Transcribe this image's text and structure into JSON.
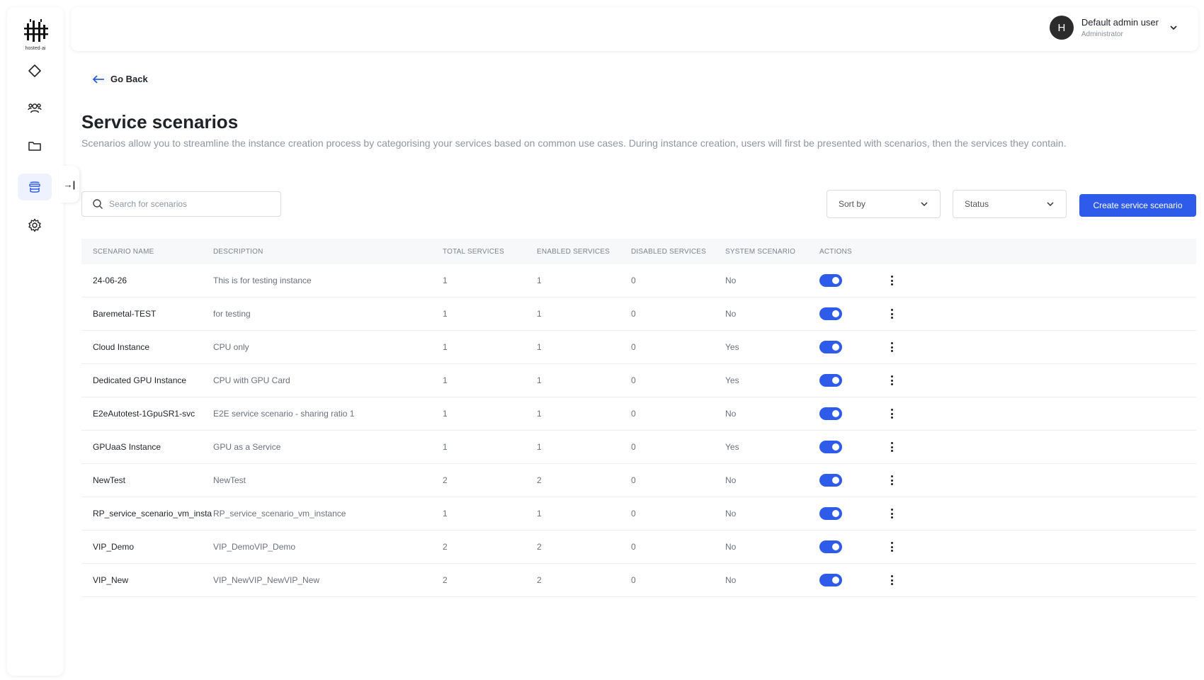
{
  "brand": {
    "logo_text": "hosted·ai"
  },
  "nav": {
    "items": [
      {
        "name": "dashboard",
        "icon": "diamond-icon"
      },
      {
        "name": "users",
        "icon": "users-icon"
      },
      {
        "name": "folders",
        "icon": "folder-icon"
      },
      {
        "name": "scenarios",
        "icon": "stack-icon",
        "active": true
      },
      {
        "name": "settings",
        "icon": "gear-icon"
      }
    ],
    "collapse_label": "→|"
  },
  "header": {
    "user": {
      "initial": "H",
      "name": "Default admin user",
      "role": "Administrator"
    }
  },
  "go_back_label": "Go Back",
  "page": {
    "title": "Service scenarios",
    "description": "Scenarios allow you to streamline the instance creation process by categorising your services based on common use cases. During instance creation, users will first be presented with scenarios, then the services they contain."
  },
  "controls": {
    "search_placeholder": "Search for scenarios",
    "sort_label": "Sort by",
    "status_label": "Status",
    "create_label": "Create service scenario"
  },
  "table": {
    "headers": {
      "name": "SCENARIO NAME",
      "description": "DESCRIPTION",
      "total": "TOTAL SERVICES",
      "enabled": "ENABLED SERVICES",
      "disabled": "DISABLED SERVICES",
      "system": "SYSTEM SCENARIO",
      "actions": "ACTIONS"
    },
    "rows": [
      {
        "name": "24-06-26",
        "description": "This is for testing instance",
        "total": "1",
        "enabled": "1",
        "disabled": "0",
        "system": "No",
        "active": true
      },
      {
        "name": "Baremetal-TEST",
        "description": "for testing",
        "total": "1",
        "enabled": "1",
        "disabled": "0",
        "system": "No",
        "active": true
      },
      {
        "name": "Cloud Instance",
        "description": "CPU only",
        "total": "1",
        "enabled": "1",
        "disabled": "0",
        "system": "Yes",
        "active": true
      },
      {
        "name": "Dedicated GPU Instance",
        "description": "CPU with GPU Card",
        "total": "1",
        "enabled": "1",
        "disabled": "0",
        "system": "Yes",
        "active": true
      },
      {
        "name": "E2eAutotest-1GpuSR1-svc",
        "description": "E2E service scenario - sharing ratio 1",
        "total": "1",
        "enabled": "1",
        "disabled": "0",
        "system": "No",
        "active": true
      },
      {
        "name": "GPUaaS Instance",
        "description": "GPU as a Service",
        "total": "1",
        "enabled": "1",
        "disabled": "0",
        "system": "Yes",
        "active": true
      },
      {
        "name": "NewTest",
        "description": "NewTest",
        "total": "2",
        "enabled": "2",
        "disabled": "0",
        "system": "No",
        "active": true
      },
      {
        "name": "RP_service_scenario_vm_instance",
        "description": "RP_service_scenario_vm_instance",
        "total": "1",
        "enabled": "1",
        "disabled": "0",
        "system": "No",
        "active": true
      },
      {
        "name": "VIP_Demo",
        "description": "VIP_DemoVIP_Demo",
        "total": "2",
        "enabled": "2",
        "disabled": "0",
        "system": "No",
        "active": true
      },
      {
        "name": "VIP_New",
        "description": "VIP_NewVIP_NewVIP_New",
        "total": "2",
        "enabled": "2",
        "disabled": "0",
        "system": "No",
        "active": true
      }
    ]
  },
  "colors": {
    "accent": "#2f5bea",
    "text": "#1f2328",
    "muted": "#9096a0"
  }
}
